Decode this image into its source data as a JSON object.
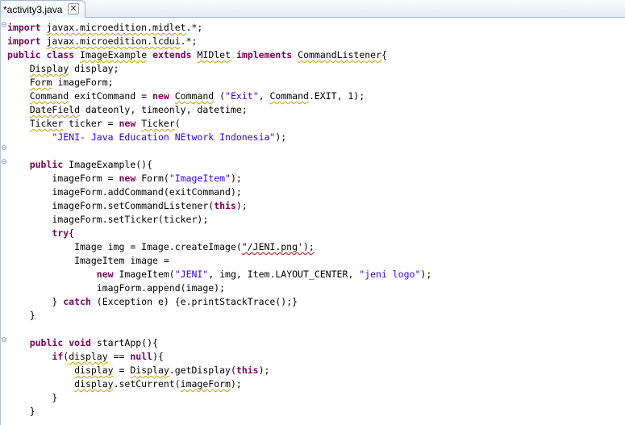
{
  "tab": {
    "title": "*activity3.java",
    "close_glyph": "✕"
  },
  "gutter": {
    "fold_glyph": "⊖"
  },
  "editor": {
    "lines": [
      [
        [
          "kw",
          "import"
        ],
        [
          "n",
          " "
        ],
        [
          "sq",
          "javax.microedition.midlet"
        ],
        [
          "n",
          ".*;"
        ]
      ],
      [
        [
          "kw",
          "import"
        ],
        [
          "n",
          " "
        ],
        [
          "sq",
          "javax.microedition.lcdui"
        ],
        [
          "n",
          ".*;"
        ]
      ],
      [
        [
          "kw",
          "public"
        ],
        [
          "n",
          " "
        ],
        [
          "kw",
          "class"
        ],
        [
          "n",
          " "
        ],
        [
          "sq",
          "ImageExample"
        ],
        [
          "n",
          " "
        ],
        [
          "kw",
          "extends"
        ],
        [
          "n",
          " "
        ],
        [
          "sq",
          "MIDlet"
        ],
        [
          "n",
          " "
        ],
        [
          "kw",
          "implements"
        ],
        [
          "n",
          " "
        ],
        [
          "sq",
          "CommandListener"
        ],
        [
          "n",
          "{"
        ]
      ],
      [
        [
          "n",
          "    "
        ],
        [
          "sq",
          "Display"
        ],
        [
          "n",
          " display;"
        ]
      ],
      [
        [
          "n",
          "    "
        ],
        [
          "sq",
          "Form"
        ],
        [
          "n",
          " imageForm;"
        ]
      ],
      [
        [
          "n",
          "    "
        ],
        [
          "sq",
          "Command"
        ],
        [
          "n",
          " exitCommand = "
        ],
        [
          "kw",
          "new"
        ],
        [
          "n",
          " "
        ],
        [
          "sq",
          "Command"
        ],
        [
          "n",
          " ("
        ],
        [
          "str",
          "\"Exit\""
        ],
        [
          "n",
          ", "
        ],
        [
          "sq",
          "Command"
        ],
        [
          "n",
          ".EXIT, 1);"
        ]
      ],
      [
        [
          "n",
          "    "
        ],
        [
          "sq",
          "DateField"
        ],
        [
          "n",
          " dateonly, timeonly, datetime;"
        ]
      ],
      [
        [
          "n",
          "    "
        ],
        [
          "sq",
          "Ticker"
        ],
        [
          "n",
          " ticker = "
        ],
        [
          "kw",
          "new"
        ],
        [
          "n",
          " "
        ],
        [
          "sq",
          "Ticker"
        ],
        [
          "n",
          "("
        ]
      ],
      [
        [
          "n",
          "        "
        ],
        [
          "str",
          "\"JENI- Java Education NEtwork Indonesia\""
        ],
        [
          "n",
          ");"
        ]
      ],
      [],
      [
        [
          "n",
          "    "
        ],
        [
          "kw",
          "public"
        ],
        [
          "n",
          " ImageExample(){"
        ]
      ],
      [
        [
          "n",
          "        imageForm = "
        ],
        [
          "kw",
          "new"
        ],
        [
          "n",
          " Form("
        ],
        [
          "str",
          "\"ImageItem\""
        ],
        [
          "n",
          ");"
        ]
      ],
      [
        [
          "n",
          "        imageForm.addCommand(exitCommand);"
        ]
      ],
      [
        [
          "n",
          "        imageForm.setCommandListener("
        ],
        [
          "kw",
          "this"
        ],
        [
          "n",
          ");"
        ]
      ],
      [
        [
          "n",
          "        imageForm.setTicker(ticker);"
        ]
      ],
      [
        [
          "n",
          "        "
        ],
        [
          "kw",
          "try"
        ],
        [
          "n",
          "{"
        ]
      ],
      [
        [
          "n",
          "            Image img = Image.createImage("
        ],
        [
          "sqr",
          "\"/JENI.png');"
        ]
      ],
      [
        [
          "n",
          "            ImageItem image ="
        ]
      ],
      [
        [
          "n",
          "                "
        ],
        [
          "kw",
          "new"
        ],
        [
          "n",
          " ImageItem("
        ],
        [
          "str",
          "\"JENI\""
        ],
        [
          "n",
          ", img, Item.LAYOUT_CENTER, "
        ],
        [
          "str",
          "\"jeni logo\""
        ],
        [
          "n",
          ");"
        ]
      ],
      [
        [
          "n",
          "                imagForm.append(image);"
        ]
      ],
      [
        [
          "n",
          "        } "
        ],
        [
          "kw",
          "catch"
        ],
        [
          "n",
          " (Exception e) {e.printStackTrace();}"
        ]
      ],
      [
        [
          "n",
          "    }"
        ]
      ],
      [],
      [
        [
          "n",
          "    "
        ],
        [
          "kw",
          "public"
        ],
        [
          "n",
          " "
        ],
        [
          "kw",
          "void"
        ],
        [
          "n",
          " startApp(){"
        ]
      ],
      [
        [
          "n",
          "        "
        ],
        [
          "kw",
          "if"
        ],
        [
          "n",
          "("
        ],
        [
          "sq",
          "display"
        ],
        [
          "n",
          " == "
        ],
        [
          "kw",
          "null"
        ],
        [
          "n",
          "){"
        ]
      ],
      [
        [
          "n",
          "            "
        ],
        [
          "sq",
          "display"
        ],
        [
          "n",
          " = "
        ],
        [
          "sq",
          "Display"
        ],
        [
          "n",
          ".getDisplay("
        ],
        [
          "kw",
          "this"
        ],
        [
          "n",
          ");"
        ]
      ],
      [
        [
          "n",
          "            "
        ],
        [
          "sq",
          "display"
        ],
        [
          "n",
          ".setCurrent("
        ],
        [
          "sq",
          "imageForm"
        ],
        [
          "n",
          ");"
        ]
      ],
      [
        [
          "n",
          "        }"
        ]
      ],
      [
        [
          "n",
          "    }"
        ]
      ]
    ]
  }
}
